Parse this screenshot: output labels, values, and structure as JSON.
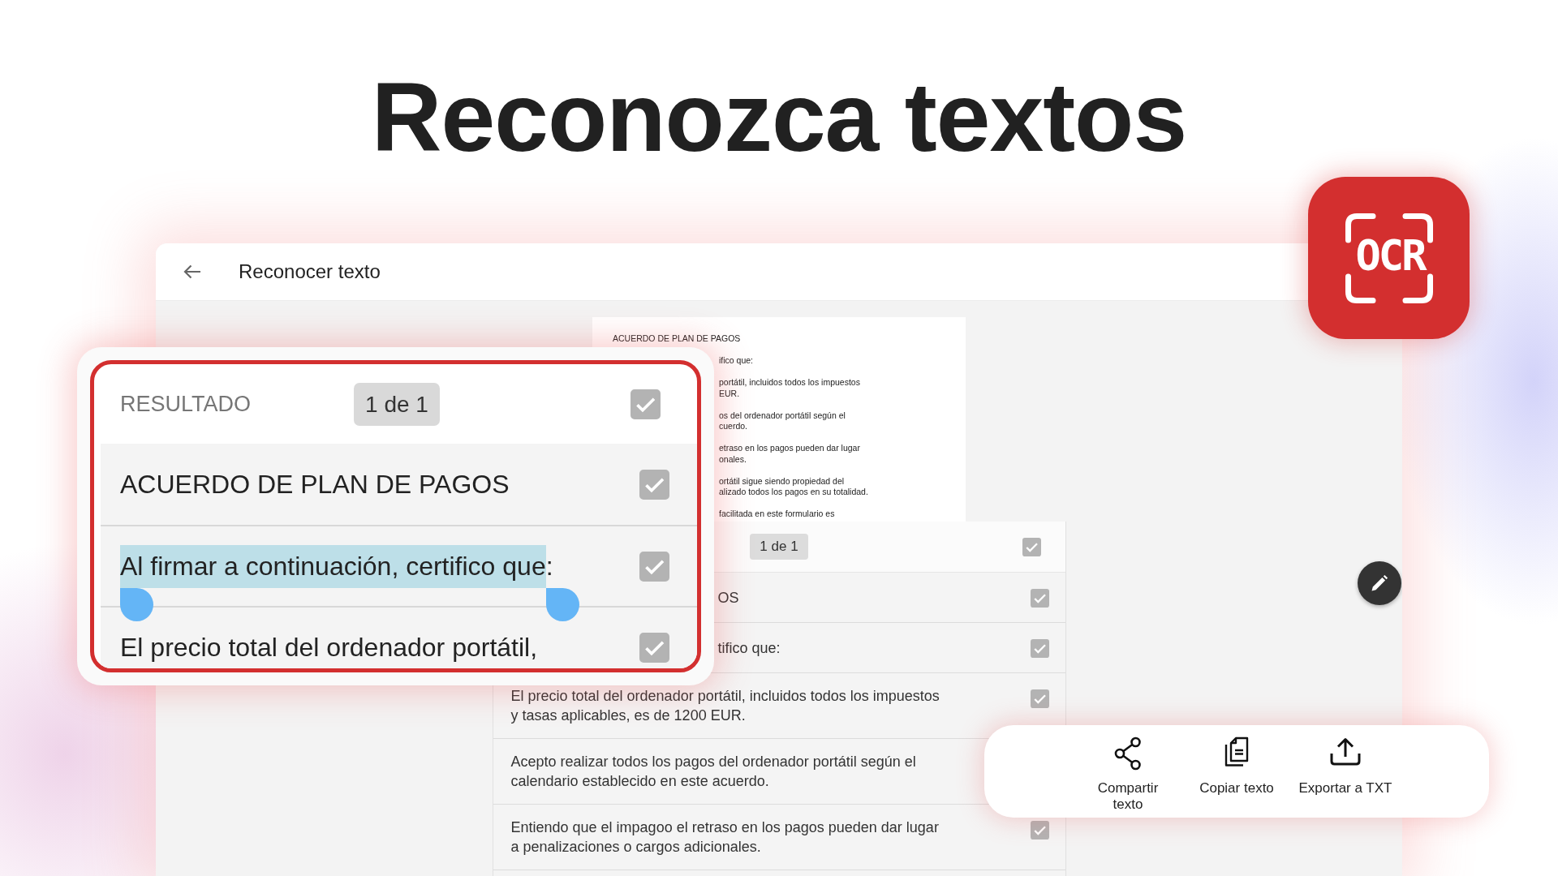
{
  "headline": "Reconozca textos",
  "app_bar": {
    "title": "Reconocer texto"
  },
  "document": {
    "paragraphs": [
      {
        "covered": false,
        "lines": [
          "ACUERDO DE PLAN DE PAGOS"
        ]
      },
      {
        "covered": true,
        "lines": [
          "ifico que:"
        ]
      },
      {
        "covered": true,
        "lines": [
          "portátil, incluidos todos los impuestos",
          "EUR."
        ]
      },
      {
        "covered": true,
        "lines": [
          "os del ordenador portátil según el",
          "cuerdo."
        ]
      },
      {
        "covered": true,
        "lines": [
          "etraso en los pagos pueden dar lugar",
          "onales."
        ]
      },
      {
        "covered": true,
        "lines": [
          "ortátil sigue siendo propiedad del",
          "alizado todos los pagos en su totalidad."
        ]
      },
      {
        "covered": true,
        "lines": [
          "facilitada en este formulario es"
        ]
      }
    ]
  },
  "sheet": {
    "page_indicator": "1 de 1",
    "header_checked": true,
    "rows": [
      {
        "text": "OS",
        "covered": true,
        "checked": true
      },
      {
        "text": "tifico que:",
        "covered": true,
        "checked": true
      },
      {
        "text": "El precio total del ordenador portátil, incluidos todos los impuestos\ny tasas aplicables, es de 1200 EUR.",
        "covered": false,
        "checked": true
      },
      {
        "text": "Acepto realizar todos los pagos del ordenador portátil según el\ncalendario establecido en este acuerdo.",
        "covered": false
      },
      {
        "text": "Entiendo que el impagoo el retraso en los pagos pueden dar lugar\na penalizaciones o cargos adicionales.",
        "covered": false,
        "checked": true
      }
    ]
  },
  "zoom_card": {
    "header": {
      "label": "RESULTADO",
      "page_indicator": "1 de 1",
      "checked": true
    },
    "rows": [
      {
        "segments": [
          {
            "text": "ACUERDO DE PLAN DE PAGOS",
            "highlighted": false
          }
        ],
        "checked": true
      },
      {
        "segments": [
          {
            "text": "Al firmar a continuación, certifico que",
            "highlighted": true
          },
          {
            "text": ":",
            "highlighted": false
          }
        ],
        "checked": true
      },
      {
        "segments": [
          {
            "text": "El precio total del ordenador portátil,",
            "highlighted": false
          }
        ],
        "checked": true
      }
    ]
  },
  "actions": [
    {
      "kind": "share",
      "label": "Compartir\ntexto"
    },
    {
      "kind": "copy",
      "label": "Copiar texto"
    },
    {
      "kind": "export",
      "label": "Exportar a TXT"
    }
  ],
  "ocr_badge": {
    "label": "OCR"
  }
}
